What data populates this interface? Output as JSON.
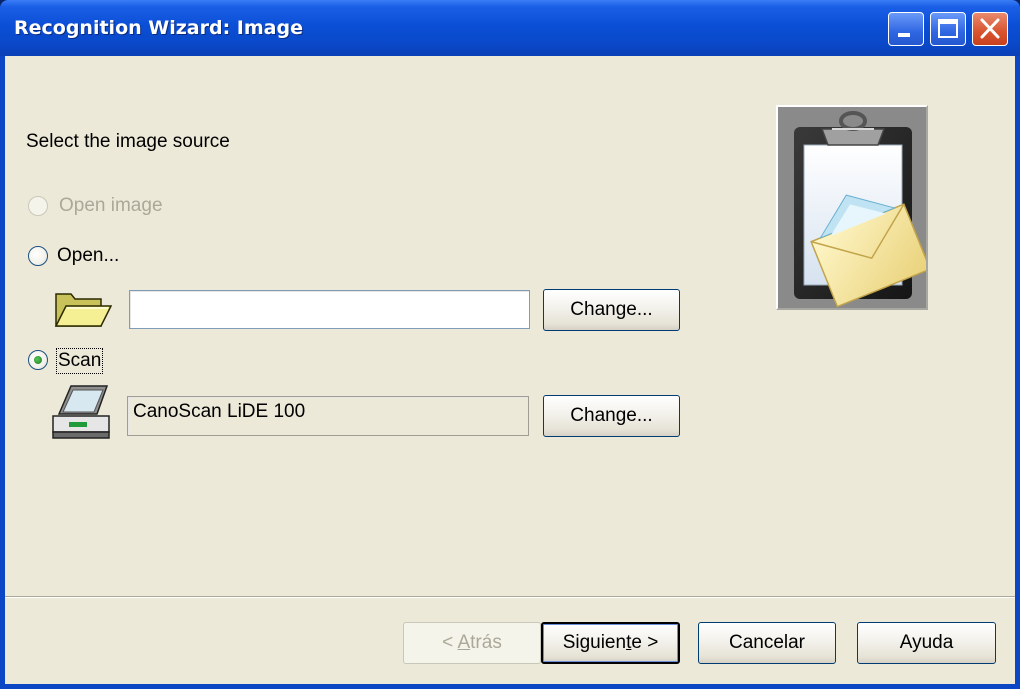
{
  "window": {
    "title": "Recognition Wizard: Image"
  },
  "main": {
    "prompt": "Select the image source",
    "options": [
      {
        "label": "Open image",
        "state": "disabled"
      },
      {
        "label": "Open...",
        "state": "unchecked"
      },
      {
        "label": "Scan",
        "state": "checked"
      }
    ],
    "open_path_value": "",
    "open_change_label": "Change...",
    "scanner_value": "CanoScan LiDE 100",
    "scan_change_label": "Change..."
  },
  "footer": {
    "back_label_prefix": "< ",
    "back_label_accel": "A",
    "back_label_rest": "trás",
    "next_label_prefix": "Siguien",
    "next_label_accel": "t",
    "next_label_rest": "e >",
    "cancel_label": "Cancelar",
    "help_label": "Ayuda"
  },
  "icons": {
    "titlebar": [
      "minimize-icon",
      "maximize-icon",
      "close-icon"
    ],
    "open": "folder-open-icon",
    "scan": "scanner-icon",
    "wizard": "clipboard-envelope-icon"
  },
  "colors": {
    "titlebar": "#0b4fd6",
    "dialog_bg": "#ece9d8",
    "disabled_text": "#aca899"
  }
}
